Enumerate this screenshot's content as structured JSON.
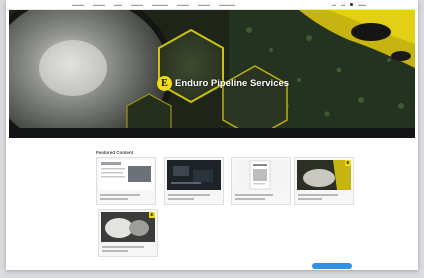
{
  "hero": {
    "brand_logo_letter": "E",
    "brand_name": "Enduro Pipeline Services"
  },
  "featured": {
    "title": "Featured Content"
  },
  "colors": {
    "accent_yellow": "#f2dc16",
    "button_blue": "#2f8fe0",
    "hero_dark": "#1b2016"
  },
  "icons": [
    "enduro-logo-icon",
    "user-avatar-icon"
  ]
}
